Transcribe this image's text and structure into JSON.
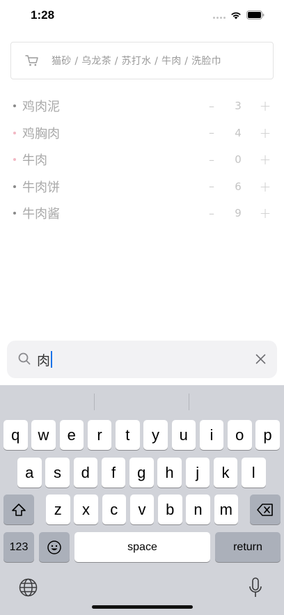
{
  "status_bar": {
    "time": "1:28"
  },
  "hint": {
    "text": "猫砂 / 乌龙茶 / 苏打水 / 牛肉 / 洗脸巾"
  },
  "items": [
    {
      "name": "鸡肉泥",
      "qty": "3",
      "minus": "–",
      "plus": "+",
      "bullet": "gray"
    },
    {
      "name": "鸡胸肉",
      "qty": "4",
      "minus": "–",
      "plus": "+",
      "bullet": "pink"
    },
    {
      "name": "牛肉",
      "qty": "0",
      "minus": "–",
      "plus": "+",
      "bullet": "pink"
    },
    {
      "name": "牛肉饼",
      "qty": "6",
      "minus": "–",
      "plus": "+",
      "bullet": "gray"
    },
    {
      "name": "牛肉酱",
      "qty": "9",
      "minus": "–",
      "plus": "+",
      "bullet": "gray"
    }
  ],
  "search": {
    "value": "肉"
  },
  "keyboard": {
    "row1": [
      "q",
      "w",
      "e",
      "r",
      "t",
      "y",
      "u",
      "i",
      "o",
      "p"
    ],
    "row2": [
      "a",
      "s",
      "d",
      "f",
      "g",
      "h",
      "j",
      "k",
      "l"
    ],
    "row3": [
      "z",
      "x",
      "c",
      "v",
      "b",
      "n",
      "m"
    ],
    "numbers_label": "123",
    "space_label": "space",
    "return_label": "return"
  },
  "colors": {
    "accent_caret": "#1a73e8",
    "keyboard_bg": "#d1d3d9"
  }
}
